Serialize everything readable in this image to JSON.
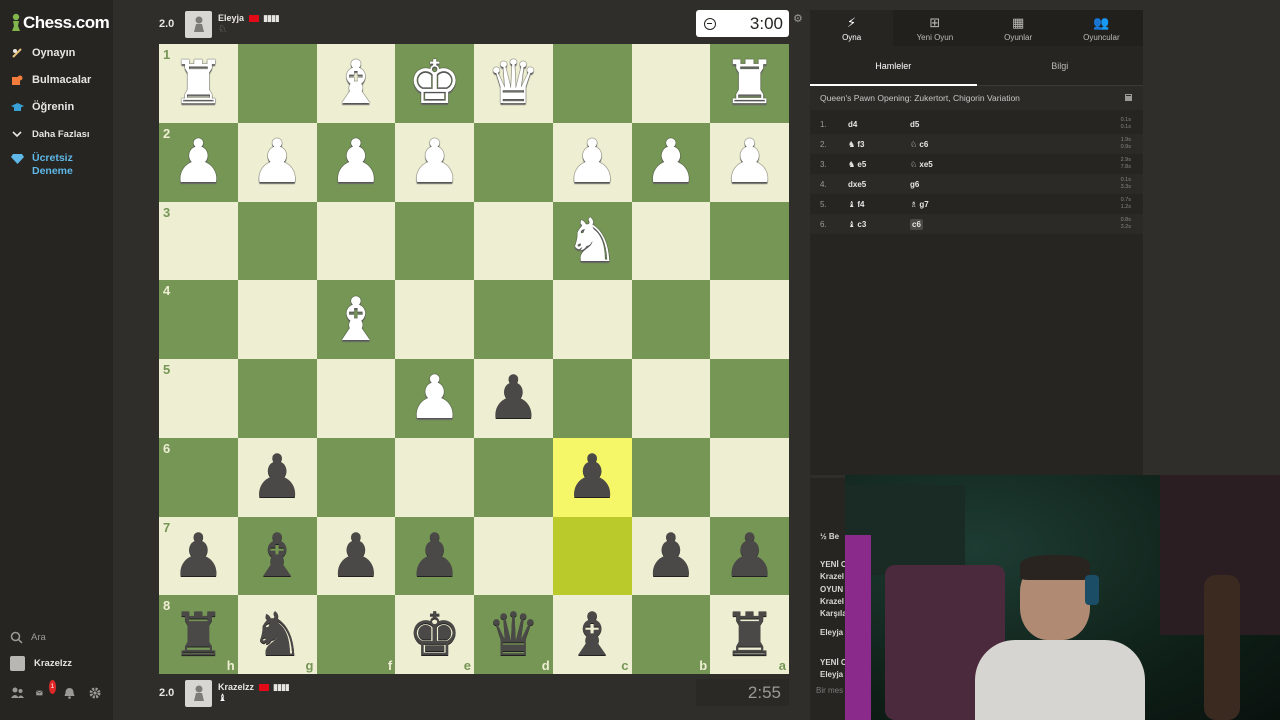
{
  "sidebar": {
    "logo": "Chess.com",
    "items": [
      {
        "label": "Oynayın",
        "icon": "play-pawn-icon",
        "color": "#e8e6e3"
      },
      {
        "label": "Bulmacalar",
        "icon": "puzzle-icon",
        "color": "#e8e6e3"
      },
      {
        "label": "Öğrenin",
        "icon": "graduation-cap-icon",
        "color": "#e8e6e3"
      },
      {
        "label": "Daha Fazlası",
        "icon": "chevron-down-icon",
        "color": "#e8e6e3"
      },
      {
        "label": "Ücretsiz Deneme",
        "icon": "diamond-icon",
        "color": "#5fb8e8"
      }
    ],
    "search_label": "Ara",
    "username": "Krazelzz",
    "notification_count": "1"
  },
  "top_player": {
    "rating": "2.0",
    "name": "Eleyja",
    "bars": "▮▮▮▮",
    "captured": "♘",
    "clock": "3:00"
  },
  "bottom_player": {
    "rating": "2.0",
    "name": "Krazelzz",
    "bars": "▮▮▮▮",
    "captured": "♝",
    "clock": "2:55"
  },
  "board": {
    "ranks": [
      "1",
      "2",
      "3",
      "4",
      "5",
      "6",
      "7",
      "8"
    ],
    "files": [
      "h",
      "g",
      "f",
      "e",
      "d",
      "c",
      "b",
      "a"
    ],
    "light_color": "#eeeed2",
    "dark_color": "#769656",
    "highlight_squares": [
      "c6",
      "c7"
    ],
    "rows": [
      [
        "wR",
        "",
        "wB",
        "wK",
        "wQ",
        "",
        "",
        "wR"
      ],
      [
        "wP",
        "wP",
        "wP",
        "wP",
        "",
        "wP",
        "wP",
        "wP"
      ],
      [
        "",
        "",
        "",
        "",
        "",
        "wN",
        "",
        ""
      ],
      [
        "",
        "",
        "wB",
        "",
        "",
        "",
        "",
        ""
      ],
      [
        "",
        "",
        "",
        "wP",
        "bP",
        "",
        "",
        ""
      ],
      [
        "",
        "bP",
        "",
        "",
        "",
        "bP",
        "",
        ""
      ],
      [
        "bP",
        "bB",
        "bP",
        "bP",
        "",
        "",
        "bP",
        "bP"
      ],
      [
        "bR",
        "bN",
        "",
        "bK",
        "bQ",
        "bB",
        "",
        "bR"
      ]
    ]
  },
  "panel": {
    "tabs": [
      {
        "label": "Oyna",
        "icon": "lightning-icon"
      },
      {
        "label": "Yeni Oyun",
        "icon": "plus-square-icon"
      },
      {
        "label": "Oyunlar",
        "icon": "board-icon"
      },
      {
        "label": "Oyuncular",
        "icon": "players-icon"
      }
    ],
    "subtabs": [
      "Hamleler",
      "Bilgi"
    ],
    "opening": "Queen's Pawn Opening: Zukertort, Chigorin Variation",
    "moves": [
      {
        "num": "1.",
        "white": "d4",
        "black": "d5",
        "tw": "0.1s",
        "tb": "0.1s"
      },
      {
        "num": "2.",
        "white": "♞ f3",
        "black": "♘ c6",
        "tw": "1.9s",
        "tb": "0.9s"
      },
      {
        "num": "3.",
        "white": "♞ e5",
        "black": "♘ xe5",
        "tw": "2.9s",
        "tb": "7.8s"
      },
      {
        "num": "4.",
        "white": "dxe5",
        "black": "g6",
        "tw": "0.1s",
        "tb": "3.3s"
      },
      {
        "num": "5.",
        "white": "♝ f4",
        "black": "♗ g7",
        "tw": "0.7s",
        "tb": "1.2s"
      },
      {
        "num": "6.",
        "white": "♝ c3",
        "black": "c6",
        "tw": "0.8s",
        "tb": "3.2s"
      }
    ]
  },
  "chat": {
    "lines": [
      "½ Be",
      "YENİ O",
      "Krazel",
      "OYUN",
      "Krazel",
      "Karşıla",
      "Eleyja",
      "YENİ O",
      "Eleyja"
    ],
    "input_placeholder": "Bir mes"
  }
}
